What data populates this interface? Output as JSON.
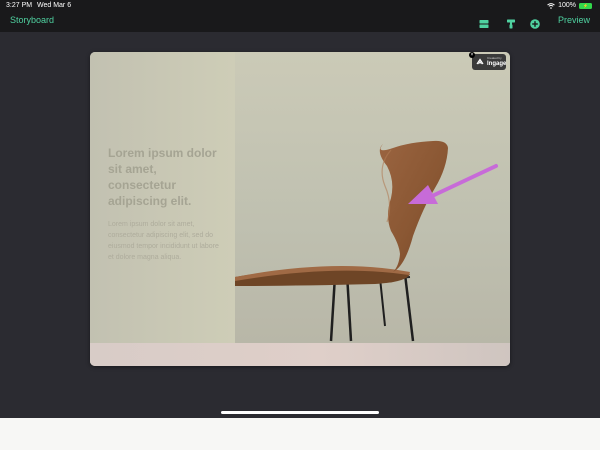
{
  "status_bar": {
    "time": "3:27 PM",
    "date": "Wed Mar 6",
    "battery_percent": "100%",
    "battery_level": 1.0
  },
  "nav": {
    "back_label": "Storyboard",
    "preview_label": "Preview",
    "icons": [
      "layout-icon",
      "paint-roller-icon",
      "add-circle-icon"
    ],
    "accent_color": "#4fd1a0"
  },
  "card": {
    "headline": "Lorem ipsum dolor sit amet, consectetur adipiscing elit.",
    "body": "Lorem ipsum dolor sit amet, consectetur adipiscing elit, sed do eiusmod tempor incididunt ut labore et dolore magna aliqua.",
    "badge_small": "Created by",
    "badge_big": "Ingage",
    "annotation_color": "#c76bd8"
  }
}
